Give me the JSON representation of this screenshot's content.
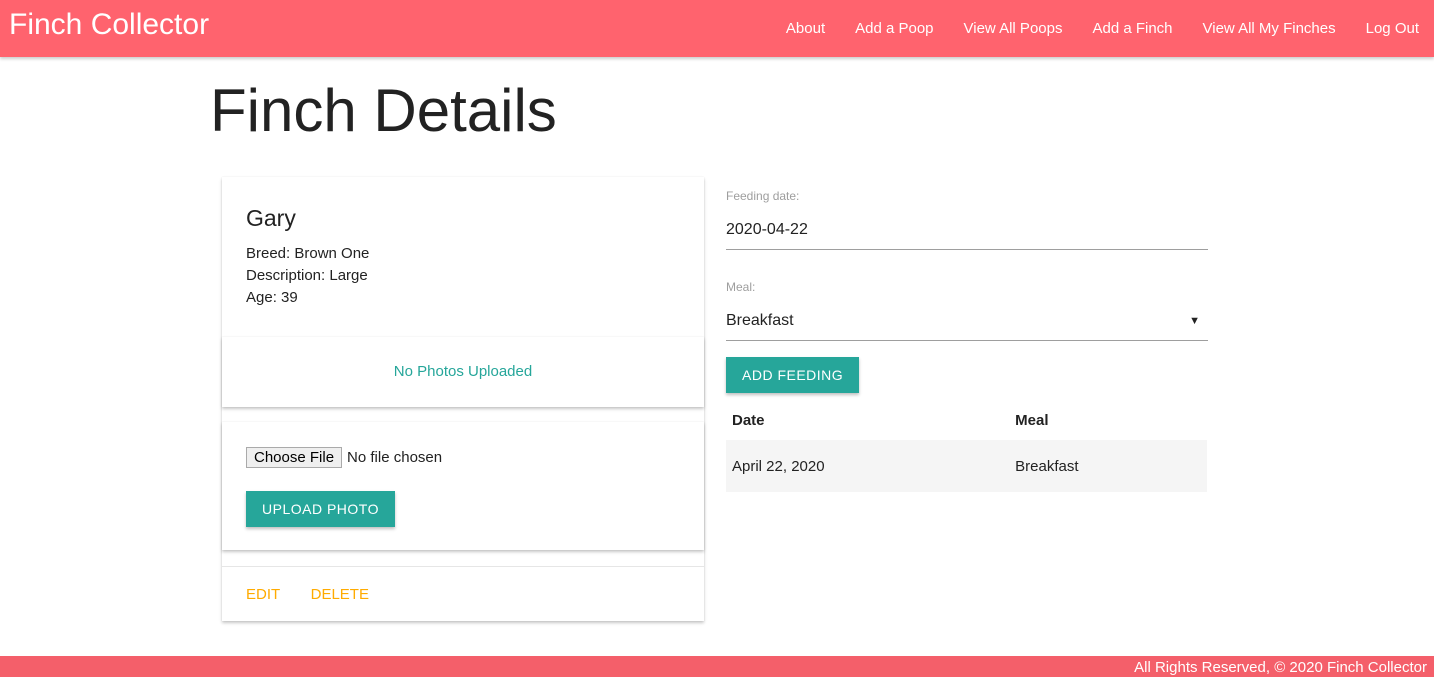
{
  "nav": {
    "brand": "Finch Collector",
    "links": [
      "About",
      "Add a Poop",
      "View All Poops",
      "Add a Finch",
      "View All My Finches",
      "Log Out"
    ]
  },
  "page_title": "Finch Details",
  "finch": {
    "name": "Gary",
    "breed": "Breed: Brown One",
    "description": "Description: Large",
    "age": "Age: 39"
  },
  "photos": {
    "empty_text": "No Photos Uploaded",
    "choose_file": "Choose File",
    "no_file": "No file chosen",
    "upload_label": "UPLOAD PHOTO"
  },
  "actions": {
    "edit": "EDIT",
    "delete": "DELETE"
  },
  "form": {
    "date_label": "Feeding date:",
    "date_value": "2020-04-22",
    "meal_label": "Meal:",
    "meal_value": "Breakfast",
    "add_label": "ADD FEEDING"
  },
  "table": {
    "headers": [
      "Date",
      "Meal"
    ],
    "rows": [
      [
        "April 22, 2020",
        "Breakfast"
      ]
    ]
  },
  "footer": "All Rights Reserved, © 2020 Finch Collector",
  "colors": {
    "primary": "#ff636e",
    "accent": "#26a69a",
    "action": "#ffab00"
  }
}
